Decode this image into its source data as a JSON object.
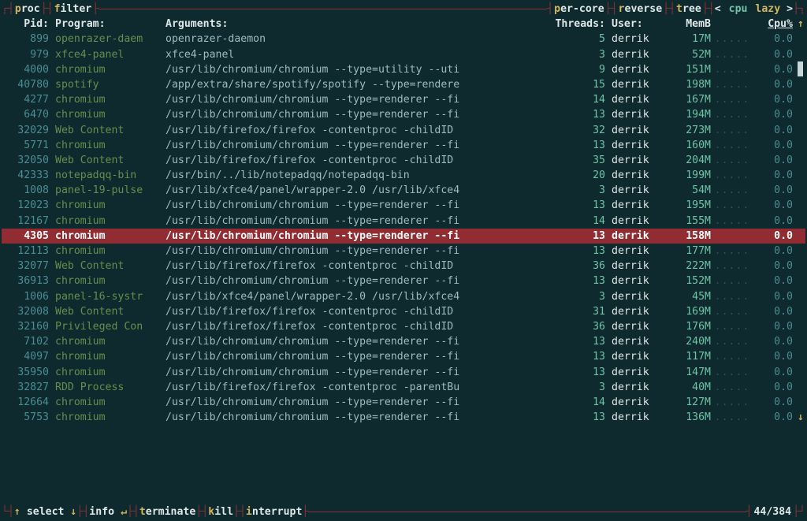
{
  "topbar": {
    "left_tabs": [
      {
        "hk": "p",
        "rest": "roc"
      },
      {
        "hk": "f",
        "rest": "ilter"
      }
    ],
    "right_tabs": [
      {
        "hk": "p",
        "rest": "er-core"
      },
      {
        "hk": "r",
        "rest": "everse"
      },
      {
        "hk": "t",
        "rest": "ree"
      }
    ],
    "sort": {
      "chev_l": "<",
      "col": "cpu",
      "mode": "lazy",
      "chev_r": ">"
    }
  },
  "headers": {
    "pid": "Pid:",
    "program": "Program:",
    "arguments": "Arguments:",
    "threads": "Threads:",
    "user": "User:",
    "mem": "MemB",
    "cpu": "Cpu%",
    "up": "↑"
  },
  "dots": ".....",
  "selected_pid": 4305,
  "processes": [
    {
      "pid": "899",
      "prog": "openrazer-daem",
      "args": "openrazer-daemon",
      "thr": "5",
      "user": "derrik",
      "mem": "17M",
      "cpu": "0.0"
    },
    {
      "pid": "979",
      "prog": "xfce4-panel",
      "args": "xfce4-panel",
      "thr": "3",
      "user": "derrik",
      "mem": "52M",
      "cpu": "0.0"
    },
    {
      "pid": "4000",
      "prog": "chromium",
      "args": "/usr/lib/chromium/chromium --type=utility --uti",
      "thr": "9",
      "user": "derrik",
      "mem": "151M",
      "cpu": "0.0"
    },
    {
      "pid": "40780",
      "prog": "spotify",
      "args": "/app/extra/share/spotify/spotify --type=rendere",
      "thr": "15",
      "user": "derrik",
      "mem": "198M",
      "cpu": "0.0"
    },
    {
      "pid": "4277",
      "prog": "chromium",
      "args": "/usr/lib/chromium/chromium --type=renderer --fi",
      "thr": "14",
      "user": "derrik",
      "mem": "167M",
      "cpu": "0.0"
    },
    {
      "pid": "6470",
      "prog": "chromium",
      "args": "/usr/lib/chromium/chromium --type=renderer --fi",
      "thr": "13",
      "user": "derrik",
      "mem": "194M",
      "cpu": "0.0"
    },
    {
      "pid": "32029",
      "prog": "Web Content",
      "args": "/usr/lib/firefox/firefox -contentproc -childID",
      "thr": "32",
      "user": "derrik",
      "mem": "273M",
      "cpu": "0.0"
    },
    {
      "pid": "5771",
      "prog": "chromium",
      "args": "/usr/lib/chromium/chromium --type=renderer --fi",
      "thr": "13",
      "user": "derrik",
      "mem": "160M",
      "cpu": "0.0"
    },
    {
      "pid": "32050",
      "prog": "Web Content",
      "args": "/usr/lib/firefox/firefox -contentproc -childID",
      "thr": "35",
      "user": "derrik",
      "mem": "204M",
      "cpu": "0.0"
    },
    {
      "pid": "42333",
      "prog": "notepadqq-bin",
      "args": "/usr/bin/../lib/notepadqq/notepadqq-bin",
      "thr": "20",
      "user": "derrik",
      "mem": "199M",
      "cpu": "0.0"
    },
    {
      "pid": "1008",
      "prog": "panel-19-pulse",
      "args": "/usr/lib/xfce4/panel/wrapper-2.0 /usr/lib/xfce4",
      "thr": "3",
      "user": "derrik",
      "mem": "54M",
      "cpu": "0.0"
    },
    {
      "pid": "12023",
      "prog": "chromium",
      "args": "/usr/lib/chromium/chromium --type=renderer --fi",
      "thr": "13",
      "user": "derrik",
      "mem": "195M",
      "cpu": "0.0"
    },
    {
      "pid": "12167",
      "prog": "chromium",
      "args": "/usr/lib/chromium/chromium --type=renderer --fi",
      "thr": "14",
      "user": "derrik",
      "mem": "155M",
      "cpu": "0.0"
    },
    {
      "pid": "4305",
      "prog": "chromium",
      "args": "/usr/lib/chromium/chromium --type=renderer --fi",
      "thr": "13",
      "user": "derrik",
      "mem": "158M",
      "cpu": "0.0"
    },
    {
      "pid": "12113",
      "prog": "chromium",
      "args": "/usr/lib/chromium/chromium --type=renderer --fi",
      "thr": "13",
      "user": "derrik",
      "mem": "177M",
      "cpu": "0.0"
    },
    {
      "pid": "32077",
      "prog": "Web Content",
      "args": "/usr/lib/firefox/firefox -contentproc -childID",
      "thr": "36",
      "user": "derrik",
      "mem": "222M",
      "cpu": "0.0"
    },
    {
      "pid": "36913",
      "prog": "chromium",
      "args": "/usr/lib/chromium/chromium --type=renderer --fi",
      "thr": "13",
      "user": "derrik",
      "mem": "152M",
      "cpu": "0.0"
    },
    {
      "pid": "1006",
      "prog": "panel-16-systr",
      "args": "/usr/lib/xfce4/panel/wrapper-2.0 /usr/lib/xfce4",
      "thr": "3",
      "user": "derrik",
      "mem": "45M",
      "cpu": "0.0"
    },
    {
      "pid": "32008",
      "prog": "Web Content",
      "args": "/usr/lib/firefox/firefox -contentproc -childID",
      "thr": "31",
      "user": "derrik",
      "mem": "169M",
      "cpu": "0.0"
    },
    {
      "pid": "32160",
      "prog": "Privileged Con",
      "args": "/usr/lib/firefox/firefox -contentproc -childID",
      "thr": "36",
      "user": "derrik",
      "mem": "176M",
      "cpu": "0.0"
    },
    {
      "pid": "7102",
      "prog": "chromium",
      "args": "/usr/lib/chromium/chromium --type=renderer --fi",
      "thr": "13",
      "user": "derrik",
      "mem": "240M",
      "cpu": "0.0"
    },
    {
      "pid": "4097",
      "prog": "chromium",
      "args": "/usr/lib/chromium/chromium --type=renderer --fi",
      "thr": "13",
      "user": "derrik",
      "mem": "117M",
      "cpu": "0.0"
    },
    {
      "pid": "35950",
      "prog": "chromium",
      "args": "/usr/lib/chromium/chromium --type=renderer --fi",
      "thr": "13",
      "user": "derrik",
      "mem": "147M",
      "cpu": "0.0"
    },
    {
      "pid": "32827",
      "prog": "RDD Process",
      "args": "/usr/lib/firefox/firefox -contentproc -parentBu",
      "thr": "3",
      "user": "derrik",
      "mem": "40M",
      "cpu": "0.0"
    },
    {
      "pid": "12664",
      "prog": "chromium",
      "args": "/usr/lib/chromium/chromium --type=renderer --fi",
      "thr": "14",
      "user": "derrik",
      "mem": "127M",
      "cpu": "0.0"
    },
    {
      "pid": "5753",
      "prog": "chromium",
      "args": "/usr/lib/chromium/chromium --type=renderer --fi",
      "thr": "13",
      "user": "derrik",
      "mem": "136M",
      "cpu": "0.0"
    }
  ],
  "bottombar": {
    "segments": [
      {
        "key": "↑",
        "label": "select",
        "key2": "↓"
      },
      {
        "key": "",
        "label": "info",
        "key2": "↵"
      },
      {
        "hk": "t",
        "label": "erminate"
      },
      {
        "hk": "k",
        "label": "ill"
      },
      {
        "hk": "i",
        "label": "nterrupt"
      }
    ],
    "counter": "44/384"
  },
  "scroll": {
    "up": "↑",
    "down": "↓"
  }
}
